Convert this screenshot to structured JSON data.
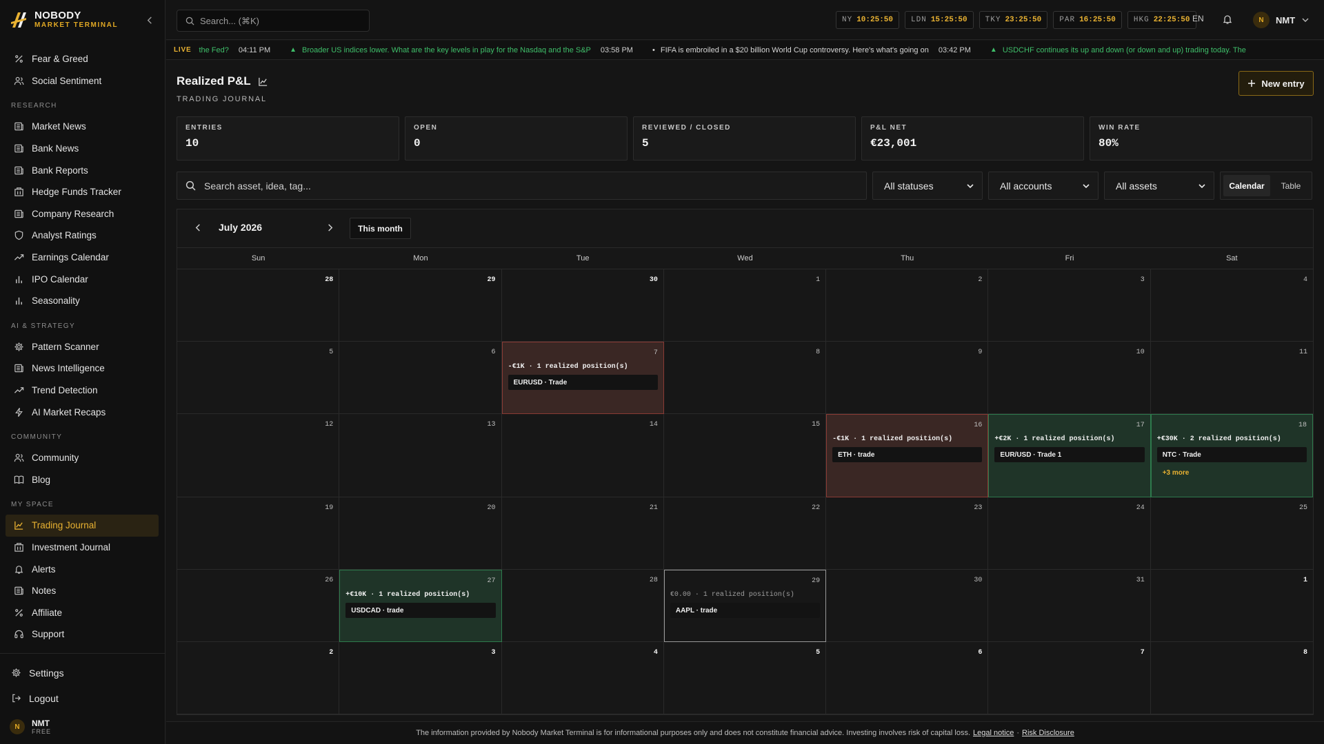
{
  "brand": {
    "name": "NOBODY",
    "tagline": "MARKET TERMINAL"
  },
  "sidebar": {
    "items_top": [
      {
        "label": "Fear & Greed",
        "icon": "percent-icon",
        "name": "sidebar-item-fear-greed"
      },
      {
        "label": "Social Sentiment",
        "icon": "users-icon",
        "name": "sidebar-item-social-sentiment"
      }
    ],
    "sections": [
      {
        "title": "RESEARCH",
        "items": [
          {
            "label": "Market News",
            "icon": "newspaper-icon",
            "name": "sidebar-item-market-news"
          },
          {
            "label": "Bank News",
            "icon": "newspaper-icon",
            "name": "sidebar-item-bank-news"
          },
          {
            "label": "Bank Reports",
            "icon": "newspaper-icon",
            "name": "sidebar-item-bank-reports"
          },
          {
            "label": "Hedge Funds Tracker",
            "icon": "building-icon",
            "name": "sidebar-item-hedge-funds-tracker"
          },
          {
            "label": "Company Research",
            "icon": "newspaper-icon",
            "name": "sidebar-item-company-research"
          },
          {
            "label": "Analyst Ratings",
            "icon": "shield-icon",
            "name": "sidebar-item-analyst-ratings"
          },
          {
            "label": "Earnings Calendar",
            "icon": "trend-icon",
            "name": "sidebar-item-earnings-calendar"
          },
          {
            "label": "IPO Calendar",
            "icon": "bar-chart-icon",
            "name": "sidebar-item-ipo-calendar"
          },
          {
            "label": "Seasonality",
            "icon": "bar-chart-icon",
            "name": "sidebar-item-seasonality"
          }
        ]
      },
      {
        "title": "AI & STRATEGY",
        "items": [
          {
            "label": "Pattern Scanner",
            "icon": "gear-icon",
            "name": "sidebar-item-pattern-scanner"
          },
          {
            "label": "News Intelligence",
            "icon": "newspaper-icon",
            "name": "sidebar-item-news-intelligence"
          },
          {
            "label": "Trend Detection",
            "icon": "trend-icon",
            "name": "sidebar-item-trend-detection"
          },
          {
            "label": "AI Market Recaps",
            "icon": "bolt-icon",
            "name": "sidebar-item-ai-market-recaps"
          }
        ]
      },
      {
        "title": "COMMUNITY",
        "items": [
          {
            "label": "Community",
            "icon": "users-icon",
            "name": "sidebar-item-community"
          },
          {
            "label": "Blog",
            "icon": "book-icon",
            "name": "sidebar-item-blog"
          }
        ]
      },
      {
        "title": "MY SPACE",
        "items": [
          {
            "label": "Trading Journal",
            "icon": "line-chart-icon",
            "name": "sidebar-item-trading-journal",
            "active": true
          },
          {
            "label": "Investment Journal",
            "icon": "building-icon",
            "name": "sidebar-item-investment-journal"
          },
          {
            "label": "Alerts",
            "icon": "bell-icon",
            "name": "sidebar-item-alerts"
          },
          {
            "label": "Notes",
            "icon": "newspaper-icon",
            "name": "sidebar-item-notes"
          },
          {
            "label": "Affiliate",
            "icon": "percent-icon",
            "name": "sidebar-item-affiliate"
          },
          {
            "label": "Support",
            "icon": "headset-icon",
            "name": "sidebar-item-support"
          }
        ]
      }
    ],
    "bottom": [
      {
        "label": "Settings",
        "icon": "gear-icon",
        "name": "settings-button"
      },
      {
        "label": "Logout",
        "icon": "logout-icon",
        "name": "logout-button"
      }
    ],
    "user": {
      "initial": "N",
      "name": "NMT",
      "plan": "FREE"
    }
  },
  "topbar": {
    "search_placeholder": "Search... (⌘K)",
    "clocks": [
      {
        "city": "NY",
        "time": "10:25:50"
      },
      {
        "city": "LDN",
        "time": "15:25:50"
      },
      {
        "city": "TKY",
        "time": "23:25:50"
      },
      {
        "city": "PAR",
        "time": "16:25:50"
      },
      {
        "city": "HKG",
        "time": "22:25:50"
      }
    ],
    "language": "EN",
    "user": {
      "initial": "N",
      "name": "NMT"
    }
  },
  "ticker": {
    "live_label": "LIVE",
    "items": [
      {
        "text": "the Fed?",
        "time": "04:11 PM",
        "tone": "up",
        "marker": ""
      },
      {
        "text": "Broader US indices lower. What are the key levels in play for the Nasdaq and the S&P",
        "time": "03:58 PM",
        "tone": "up",
        "marker": "▲"
      },
      {
        "text": "FIFA is embroiled in a $20 billion World Cup controversy. Here's what's going on",
        "time": "03:42 PM",
        "tone": "neutral",
        "marker": "•"
      },
      {
        "text": "USDCHF continues its up and down (or down and up) trading today. The",
        "time": "",
        "tone": "up",
        "marker": "▲"
      }
    ]
  },
  "page": {
    "title": "Realized P&L",
    "subtitle": "TRADING JOURNAL",
    "new_entry_label": "New entry"
  },
  "stats": [
    {
      "label": "ENTRIES",
      "value": "10"
    },
    {
      "label": "OPEN",
      "value": "0"
    },
    {
      "label": "REVIEWED / CLOSED",
      "value": "5"
    },
    {
      "label": "P&L NET",
      "value": "€23,001"
    },
    {
      "label": "WIN RATE",
      "value": "80%"
    }
  ],
  "filters": {
    "search_placeholder": "Search asset, idea, tag...",
    "status": "All statuses",
    "account": "All accounts",
    "asset": "All assets",
    "view_calendar": "Calendar",
    "view_table": "Table"
  },
  "calendar": {
    "month_label": "July 2026",
    "this_month_label": "This month",
    "weekdays": [
      "Sun",
      "Mon",
      "Tue",
      "Wed",
      "Thu",
      "Fri",
      "Sat"
    ],
    "days": [
      {
        "d": "28",
        "out": true
      },
      {
        "d": "29",
        "out": true
      },
      {
        "d": "30",
        "out": true
      },
      {
        "d": "1"
      },
      {
        "d": "2"
      },
      {
        "d": "3"
      },
      {
        "d": "4"
      },
      {
        "d": "5"
      },
      {
        "d": "6"
      },
      {
        "d": "7",
        "kind": "loss",
        "summary": "-€1K · 1 realized position(s)",
        "trade": "EURUSD · Trade"
      },
      {
        "d": "8"
      },
      {
        "d": "9"
      },
      {
        "d": "10"
      },
      {
        "d": "11"
      },
      {
        "d": "12"
      },
      {
        "d": "13"
      },
      {
        "d": "14"
      },
      {
        "d": "15"
      },
      {
        "d": "16",
        "kind": "loss",
        "summary": "-€1K · 1 realized position(s)",
        "trade": "ETH · trade"
      },
      {
        "d": "17",
        "kind": "gain",
        "summary": "+€2K · 1 realized position(s)",
        "trade": "EUR/USD · Trade 1"
      },
      {
        "d": "18",
        "kind": "gain",
        "summary": "+€30K · 2 realized position(s)",
        "trade": "NTC · Trade",
        "more": "+3 more"
      },
      {
        "d": "19"
      },
      {
        "d": "20"
      },
      {
        "d": "21"
      },
      {
        "d": "22"
      },
      {
        "d": "23"
      },
      {
        "d": "24"
      },
      {
        "d": "25"
      },
      {
        "d": "26"
      },
      {
        "d": "27",
        "kind": "gain",
        "summary": "+€10K · 1 realized position(s)",
        "trade": "USDCAD · trade"
      },
      {
        "d": "28"
      },
      {
        "d": "29",
        "kind": "flat",
        "summary": "€0.00 · 1 realized position(s)",
        "trade": "AAPL · trade"
      },
      {
        "d": "30"
      },
      {
        "d": "31"
      },
      {
        "d": "1",
        "out": true
      },
      {
        "d": "2",
        "out": true
      },
      {
        "d": "3",
        "out": true
      },
      {
        "d": "4",
        "out": true
      },
      {
        "d": "5",
        "out": true
      },
      {
        "d": "6",
        "out": true
      },
      {
        "d": "7",
        "out": true
      },
      {
        "d": "8",
        "out": true
      }
    ]
  },
  "footer": {
    "text": "The information provided by Nobody Market Terminal is for informational purposes only and does not constitute financial advice. Investing involves risk of capital loss.",
    "legal_link": "Legal notice",
    "separator": "·",
    "risk_link": "Risk Disclosure"
  },
  "colors": {
    "accent": "#e9b232",
    "gain": "#2e7a4c",
    "loss": "#8a3b35"
  }
}
